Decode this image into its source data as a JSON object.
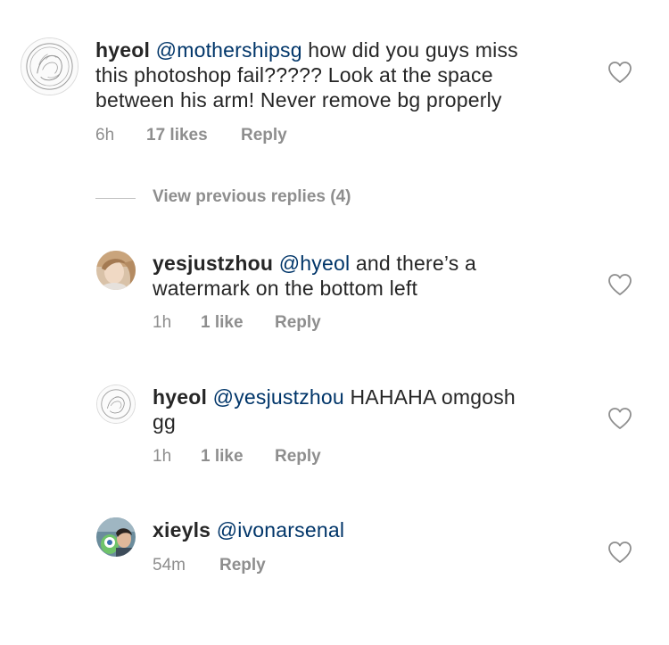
{
  "comments": [
    {
      "username": "hyeol",
      "mention": "@mothershipsg",
      "text_line1": " how did you guys miss",
      "text_line2": "this photoshop fail????? Look at the space",
      "text_line3": "between his arm! Never remove bg properly",
      "time": "6h",
      "likes": "17 likes",
      "reply": "Reply"
    },
    {
      "username": "yesjustzhou",
      "mention": "@hyeol",
      "text_line1": " and there’s a",
      "text_line2": "watermark on the bottom left",
      "time": "1h",
      "likes": "1 like",
      "reply": "Reply"
    },
    {
      "username": "hyeol",
      "mention": "@yesjustzhou",
      "text_line1": " HAHAHA omgosh",
      "text_line2": "gg",
      "time": "1h",
      "likes": "1 like",
      "reply": "Reply"
    },
    {
      "username": "xieyls",
      "mention": "@ivonarsenal",
      "time": "54m",
      "reply": "Reply"
    }
  ],
  "view_previous": "View previous replies (4)",
  "icons": {
    "heart": "heart-outline-icon",
    "avatar_sketch": "sketch-avatar-icon"
  },
  "colors": {
    "text": "#262626",
    "mention": "#003569",
    "meta": "#8e8e8e",
    "heart_stroke": "#8e8e8e"
  }
}
